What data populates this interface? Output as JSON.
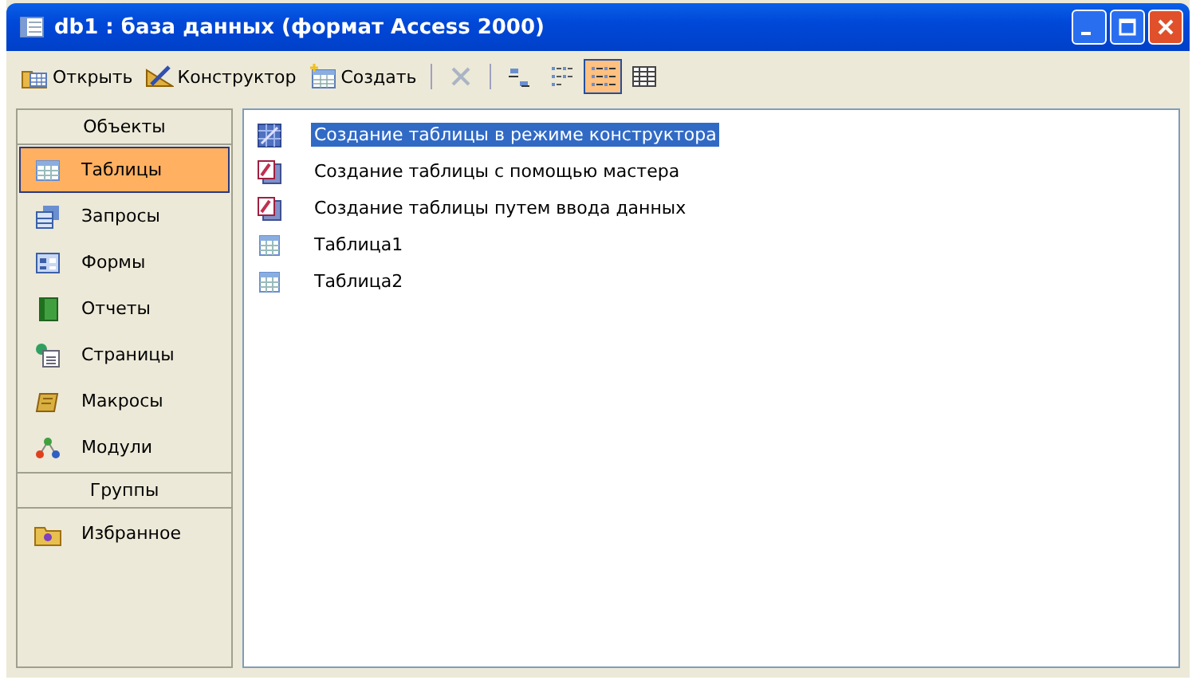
{
  "window": {
    "title": "db1 : база данных (формат Access 2000)"
  },
  "toolbar": [
    {
      "kind": "text",
      "label": "Открыть",
      "disabled": false,
      "selected": false
    },
    {
      "kind": "text",
      "label": "Конструктор",
      "disabled": false,
      "selected": false
    },
    {
      "kind": "text",
      "label": "Создать",
      "disabled": false,
      "selected": false
    },
    {
      "kind": "separator"
    },
    {
      "kind": "delete",
      "disabled": true,
      "selected": false
    },
    {
      "kind": "separator"
    },
    {
      "kind": "large-icons",
      "disabled": false,
      "selected": false
    },
    {
      "kind": "small-icons",
      "disabled": false,
      "selected": false
    },
    {
      "kind": "list",
      "disabled": false,
      "selected": true
    },
    {
      "kind": "details",
      "disabled": false,
      "selected": false
    }
  ],
  "sidebar": {
    "sections": [
      {
        "header": "Объекты",
        "items": [
          {
            "label": "Таблицы",
            "selected": true
          },
          {
            "label": "Запросы",
            "selected": false
          },
          {
            "label": "Формы",
            "selected": false
          },
          {
            "label": "Отчеты",
            "selected": false
          },
          {
            "label": "Страницы",
            "selected": false
          },
          {
            "label": "Макросы",
            "selected": false
          },
          {
            "label": "Модули",
            "selected": false
          }
        ]
      },
      {
        "header": "Группы",
        "items": [
          {
            "label": "Избранное",
            "selected": false
          }
        ]
      }
    ]
  },
  "objects": [
    {
      "kind": "design",
      "label": "Создание таблицы в режиме конструктора",
      "selected": true
    },
    {
      "kind": "wizard",
      "label": "Создание таблицы с помощью мастера",
      "selected": false
    },
    {
      "kind": "wizard",
      "label": "Создание таблицы путем ввода данных",
      "selected": false
    },
    {
      "kind": "table",
      "label": "Таблица1",
      "selected": false
    },
    {
      "kind": "table",
      "label": "Таблица2",
      "selected": false
    }
  ]
}
